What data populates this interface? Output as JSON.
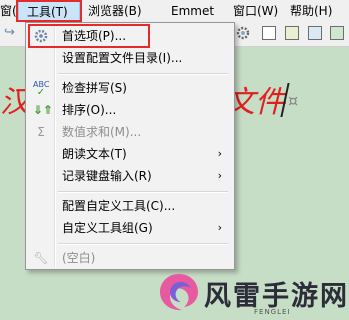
{
  "menubar": {
    "items": [
      {
        "label": "窗(F)"
      },
      {
        "label": "工具(T)"
      },
      {
        "label": "浏览器(B)"
      },
      {
        "label": "Emmet"
      },
      {
        "label": "窗口(W)"
      },
      {
        "label": "帮助(H)"
      }
    ]
  },
  "editor": {
    "text_left": "汉",
    "text_right": "文件"
  },
  "tools_menu": {
    "items": [
      {
        "label": "首选项(P)...",
        "icon": "gear-icon"
      },
      {
        "label": "设置配置文件目录(I)...",
        "icon": ""
      },
      {
        "label": "检查拼写(S)",
        "icon": "spellcheck-icon"
      },
      {
        "label": "排序(O)...",
        "icon": "sort-icon"
      },
      {
        "label": "数值求和(M)...",
        "icon": "sum-icon"
      },
      {
        "label": "朗读文本(T)",
        "icon": ""
      },
      {
        "label": "记录键盘输入(R)",
        "icon": ""
      },
      {
        "label": "配置自定义工具(C)...",
        "icon": ""
      },
      {
        "label": "自定义工具组(G)",
        "icon": ""
      },
      {
        "label": "(空白)",
        "icon": "wrench-icon"
      }
    ],
    "submenu_arrow": "›"
  },
  "watermark": {
    "name": "风雷手游网",
    "sub": "FENGLEI"
  },
  "colors": {
    "highlight": "#e52b2b",
    "editor_bg": "#c6ddc6",
    "editor_text": "#e02020"
  }
}
